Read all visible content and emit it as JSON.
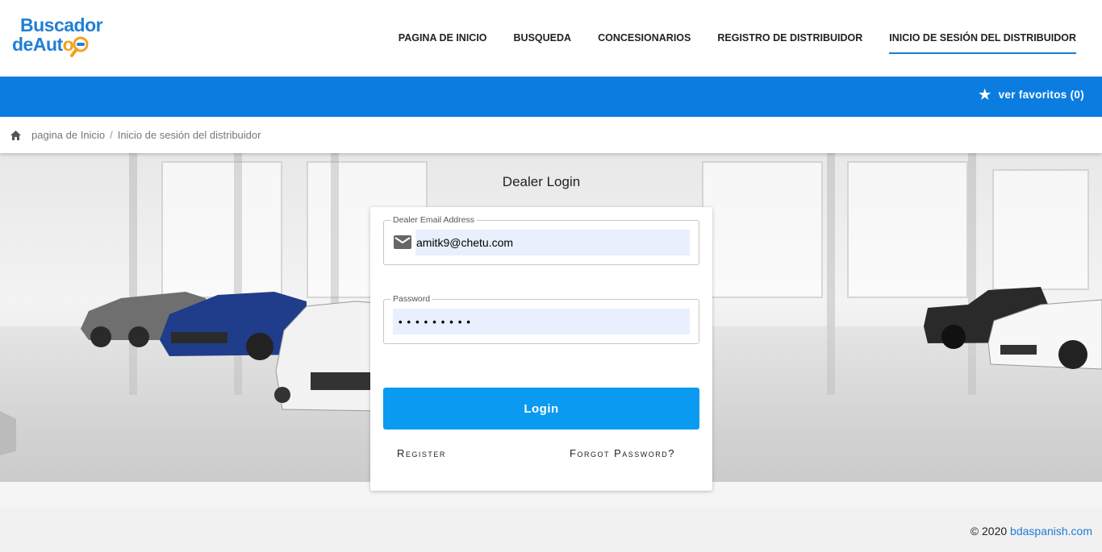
{
  "logo": {
    "line1": "Buscador",
    "line2": "deAut",
    "line2_o": "o"
  },
  "nav": {
    "items": [
      {
        "label": "PAGINA DE INICIO"
      },
      {
        "label": "BUSQUEDA"
      },
      {
        "label": "CONCESIONARIOS"
      },
      {
        "label": "REGISTRO DE DISTRIBUIDOR"
      },
      {
        "label": "INICIO DE SESIÓN DEL DISTRIBUIDOR"
      }
    ],
    "active_index": 4
  },
  "favorites": {
    "icon": "star-icon",
    "label": "ver favoritos (0)"
  },
  "breadcrumb": {
    "home_icon": "home-icon",
    "home": "pagina de Inicio",
    "separator": "/",
    "current": "Inicio de sesión del distribuidor"
  },
  "login": {
    "title": "Dealer Login",
    "email_label": "Dealer Email Address",
    "email_value": "amitk9@chetu.com",
    "email_icon": "mail-icon",
    "password_label": "Password",
    "password_value": "•••••••••",
    "button": "Login",
    "register": "Register",
    "forgot": "Forgot Password?"
  },
  "footer": {
    "copyright": "© 2020",
    "link": "bdaspanish.com"
  },
  "colors": {
    "primary_blue": "#0b7de0",
    "button_blue": "#0a9af2",
    "autofill_bg": "#e8f0fe",
    "logo_orange": "#f2a21e"
  }
}
